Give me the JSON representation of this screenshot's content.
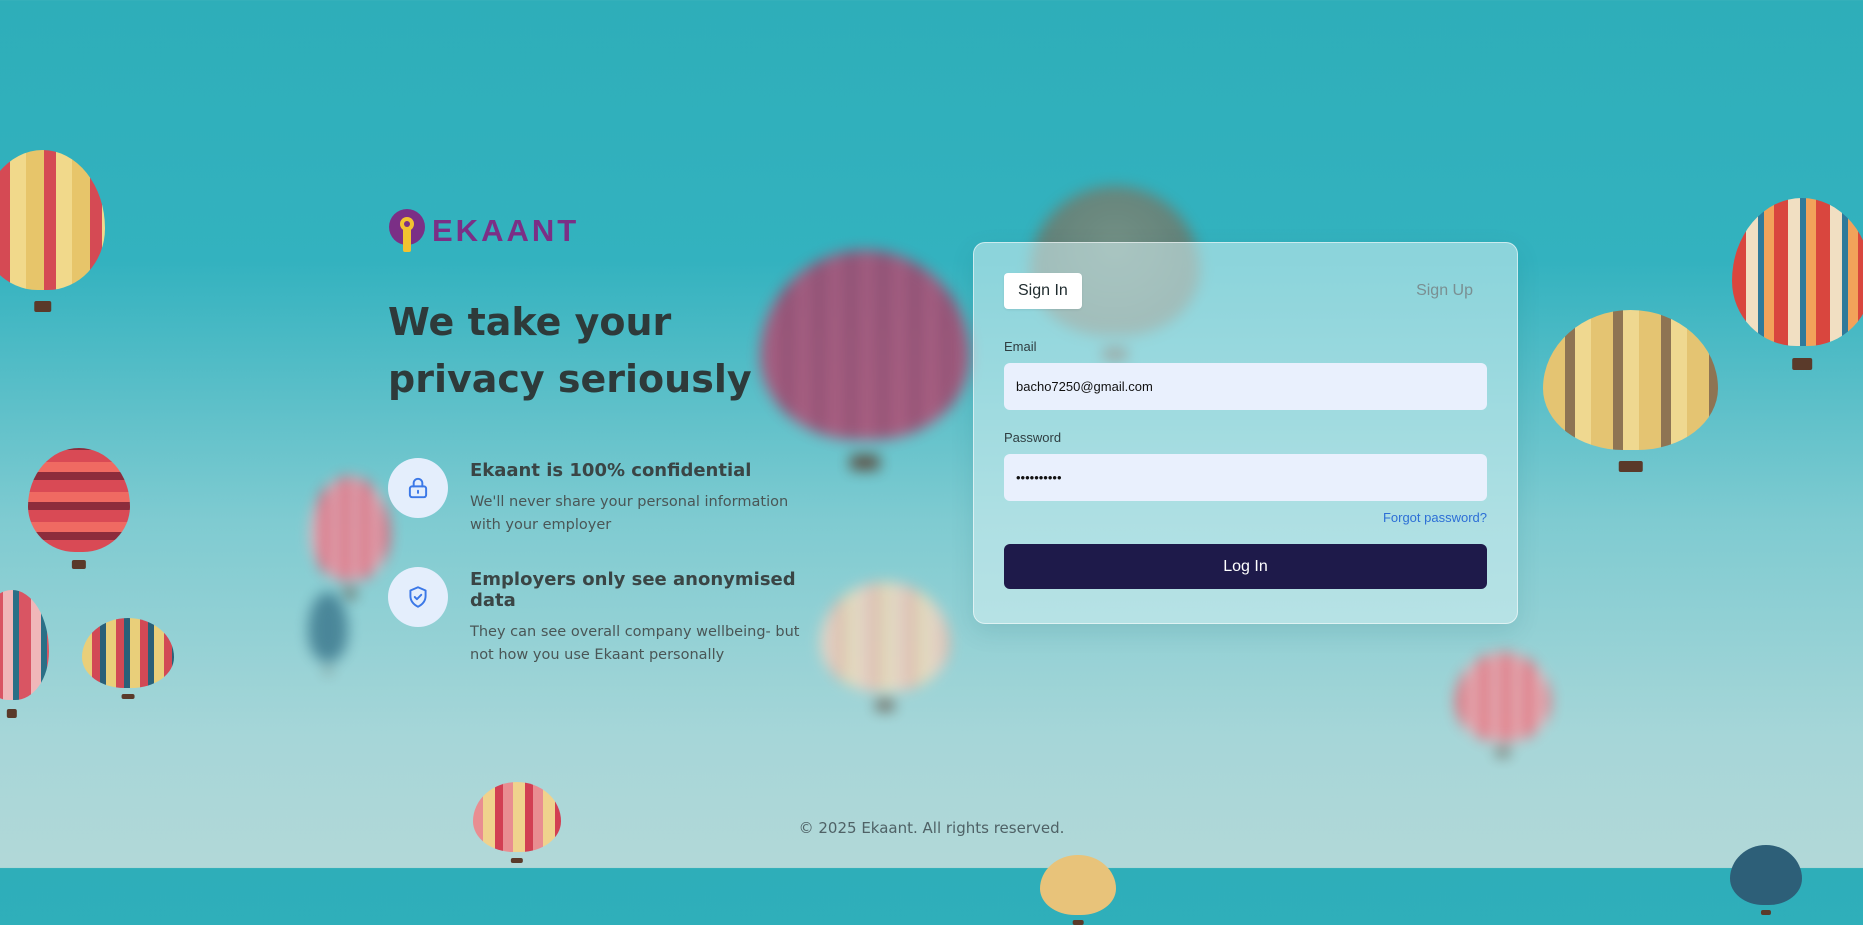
{
  "brand": {
    "name": "EKAANT",
    "logo_icon": "pin-keyhole-logo"
  },
  "hero": {
    "headline": "We take your privacy seriously",
    "features": [
      {
        "icon": "lock-icon",
        "title": "Ekaant is 100% confidential",
        "description": "We'll never share your personal information with your employer"
      },
      {
        "icon": "shield-check-icon",
        "title": "Employers only see anonymised data",
        "description": "They can see overall company wellbeing- but not how you use Ekaant personally"
      }
    ]
  },
  "auth": {
    "tabs": {
      "sign_in": "Sign In",
      "sign_up": "Sign Up"
    },
    "email_label": "Email",
    "email_value": "bacho7250@gmail.com",
    "password_label": "Password",
    "password_value": "••••••••••",
    "forgot_link": "Forgot password?",
    "submit_label": "Log In"
  },
  "footer": {
    "copyright": "© 2025 Ekaant. All rights reserved."
  },
  "colors": {
    "brand_purple": "#7b2f86",
    "brand_yellow": "#f2c230",
    "button_navy": "#1e1a4a",
    "link_blue": "#2d6fd6",
    "input_bg": "#e9f0fd"
  }
}
